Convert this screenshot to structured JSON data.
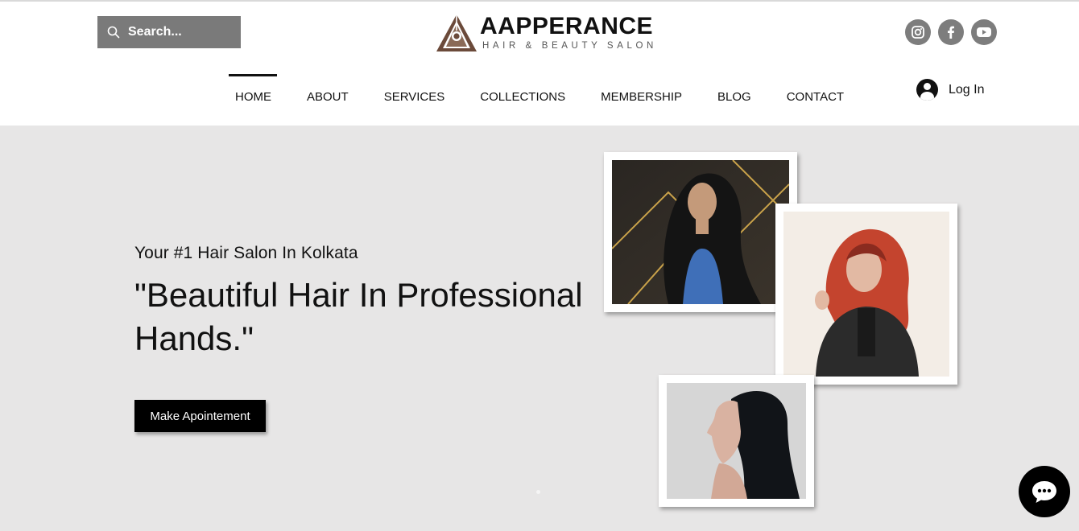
{
  "search": {
    "placeholder": "Search..."
  },
  "logo": {
    "brand": "AAPPERANCE",
    "tagline": "HAIR & BEAUTY SALON"
  },
  "social": [
    {
      "name": "instagram-icon"
    },
    {
      "name": "facebook-icon"
    },
    {
      "name": "youtube-icon"
    }
  ],
  "nav": {
    "items": [
      "HOME",
      "ABOUT",
      "SERVICES",
      "COLLECTIONS",
      "MEMBERSHIP",
      "BLOG",
      "CONTACT"
    ],
    "active": "HOME"
  },
  "login": {
    "label": "Log In"
  },
  "hero": {
    "kicker": "Your #1 Hair Salon In Kolkata",
    "headline": "\"Beautiful Hair In Professional Hands.\"",
    "cta": "Make Apointement"
  },
  "colors": {
    "hero_bg": "#e7e6e6",
    "search_bg": "#7a7a7a",
    "social_bg": "#7d7d7d",
    "button_bg": "#000000",
    "logo_brown": "#6b4a3a"
  }
}
